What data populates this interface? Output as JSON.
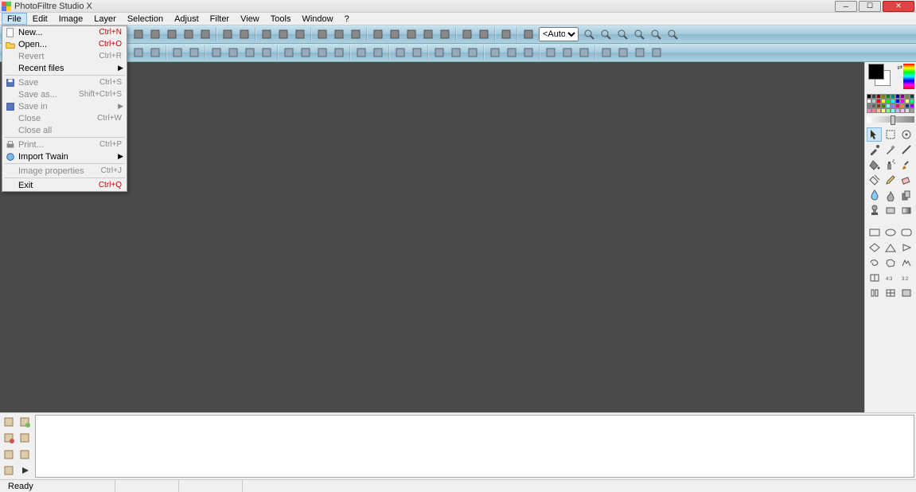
{
  "app": {
    "title": "PhotoFiltre Studio X"
  },
  "menus": [
    "File",
    "Edit",
    "Image",
    "Layer",
    "Selection",
    "Adjust",
    "Filter",
    "View",
    "Tools",
    "Window",
    "?"
  ],
  "file_menu": {
    "items": [
      {
        "label": "New...",
        "shortcut": "Ctrl+N",
        "icon": "new",
        "red": true
      },
      {
        "label": "Open...",
        "shortcut": "Ctrl+O",
        "icon": "open",
        "red": true
      },
      {
        "label": "Revert",
        "shortcut": "Ctrl+R",
        "disabled": true
      },
      {
        "label": "Recent files",
        "arrow": true
      },
      {
        "sep": true
      },
      {
        "label": "Save",
        "shortcut": "Ctrl+S",
        "icon": "save",
        "disabled": true
      },
      {
        "label": "Save as...",
        "shortcut": "Shift+Ctrl+S",
        "disabled": true
      },
      {
        "label": "Save in",
        "arrow": true,
        "icon": "savein",
        "disabled": true
      },
      {
        "label": "Close",
        "shortcut": "Ctrl+W",
        "disabled": true
      },
      {
        "label": "Close all",
        "disabled": true
      },
      {
        "sep": true
      },
      {
        "label": "Print...",
        "shortcut": "Ctrl+P",
        "icon": "print",
        "disabled": true
      },
      {
        "label": "Import Twain",
        "arrow": true,
        "icon": "twain"
      },
      {
        "sep": true
      },
      {
        "label": "Image properties",
        "shortcut": "Ctrl+J",
        "disabled": true
      },
      {
        "sep": true
      },
      {
        "label": "Exit",
        "shortcut": "Ctrl+Q",
        "red": true
      }
    ]
  },
  "toolbar1": {
    "zoom_value": "<Auto>",
    "buttons": [
      "new",
      "open",
      "save",
      "print",
      "twain",
      "sep",
      "undo",
      "redo",
      "sep",
      "copy",
      "paste",
      "clip",
      "sep",
      "rgb",
      "layers",
      "fx",
      "sep",
      "resize",
      "canvas",
      "text",
      "textv",
      "crop",
      "sep",
      "auto1",
      "auto2",
      "sep",
      "picture",
      "sep",
      "zoomsel"
    ],
    "zoom_btns": [
      "zoomin",
      "zoomout",
      "fit",
      "actual",
      "full",
      "explore"
    ]
  },
  "toolbar2": {
    "buttons": [
      "back",
      "fwd",
      "sep",
      "flip-h",
      "flip-v",
      "sep",
      "bright-",
      "bright+",
      "contrast-",
      "contrast+",
      "sep",
      "gamma-",
      "gamma+",
      "sat-",
      "sat+",
      "sep",
      "hist",
      "levels",
      "sep",
      "gray",
      "sepia",
      "sep",
      "sharp",
      "soft",
      "blur",
      "sep",
      "art1",
      "art2",
      "art3",
      "sep",
      "b1",
      "b2",
      "b3",
      "sep",
      "c1",
      "c2",
      "c3",
      "c4"
    ]
  },
  "palette": {
    "colors": [
      "#000000",
      "#404040",
      "#800000",
      "#808000",
      "#008000",
      "#008080",
      "#000080",
      "#800080",
      "#808040",
      "#004040",
      "#ffffff",
      "#c0c0c0",
      "#ff0000",
      "#ffff00",
      "#00ff00",
      "#00ffff",
      "#0000ff",
      "#ff00ff",
      "#ffff80",
      "#00ff80",
      "#808080",
      "#606060",
      "#804000",
      "#408000",
      "#80ffff",
      "#8080ff",
      "#ff0080",
      "#ff8040",
      "#004080",
      "#8000ff",
      "#ff80c0",
      "#ff8080",
      "#ffc080",
      "#ffff80",
      "#80ff80",
      "#80ffff",
      "#c0c0ff",
      "#ffc0ff",
      "#e0e0e0",
      "#a0a0a0"
    ]
  },
  "status": {
    "ready": "Ready"
  }
}
